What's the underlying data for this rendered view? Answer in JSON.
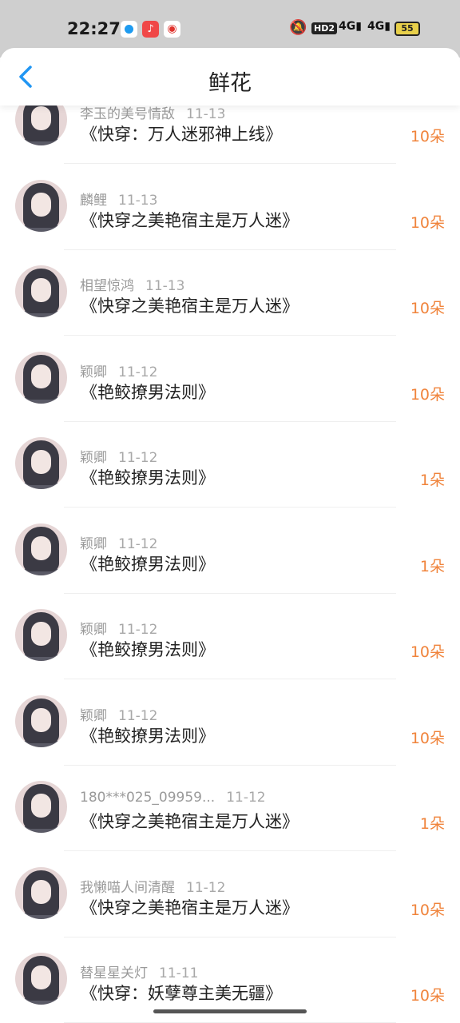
{
  "status_bar": {
    "time": "22:27",
    "hd_label": "HD2",
    "signal1": "4G",
    "signal2": "4G",
    "battery": "55",
    "icons": [
      "bell-muted-icon",
      "signal-icon",
      "battery-icon"
    ]
  },
  "nav": {
    "title": "鲜花",
    "back_icon": "chevron-left-icon"
  },
  "colors": {
    "accent": "#2196f3",
    "count": "#f0843c"
  },
  "rows": [
    {
      "user": "李玉的美号情敌",
      "date": "11-13",
      "book": "《快穿：万人迷邪神上线》",
      "count": "10朵"
    },
    {
      "user": "麟鲤",
      "date": "11-13",
      "book": "《快穿之美艳宿主是万人迷》",
      "count": "10朵"
    },
    {
      "user": "相望惊鸿",
      "date": "11-13",
      "book": "《快穿之美艳宿主是万人迷》",
      "count": "10朵"
    },
    {
      "user": "颖卿",
      "date": "11-12",
      "book": "《艳鲛撩男法则》",
      "count": "10朵"
    },
    {
      "user": "颖卿",
      "date": "11-12",
      "book": "《艳鲛撩男法则》",
      "count": "1朵"
    },
    {
      "user": "颖卿",
      "date": "11-12",
      "book": "《艳鲛撩男法则》",
      "count": "1朵"
    },
    {
      "user": "颖卿",
      "date": "11-12",
      "book": "《艳鲛撩男法则》",
      "count": "10朵"
    },
    {
      "user": "颖卿",
      "date": "11-12",
      "book": "《艳鲛撩男法则》",
      "count": "10朵"
    },
    {
      "user": "180***025_09959...",
      "date": "11-12",
      "book": "《快穿之美艳宿主是万人迷》",
      "count": "1朵"
    },
    {
      "user": "我懒喵人间清醒",
      "date": "11-12",
      "book": "《快穿之美艳宿主是万人迷》",
      "count": "10朵"
    },
    {
      "user": "替星星关灯",
      "date": "11-11",
      "book": "《快穿：妖孽尊主美无疆》",
      "count": "10朵"
    }
  ]
}
